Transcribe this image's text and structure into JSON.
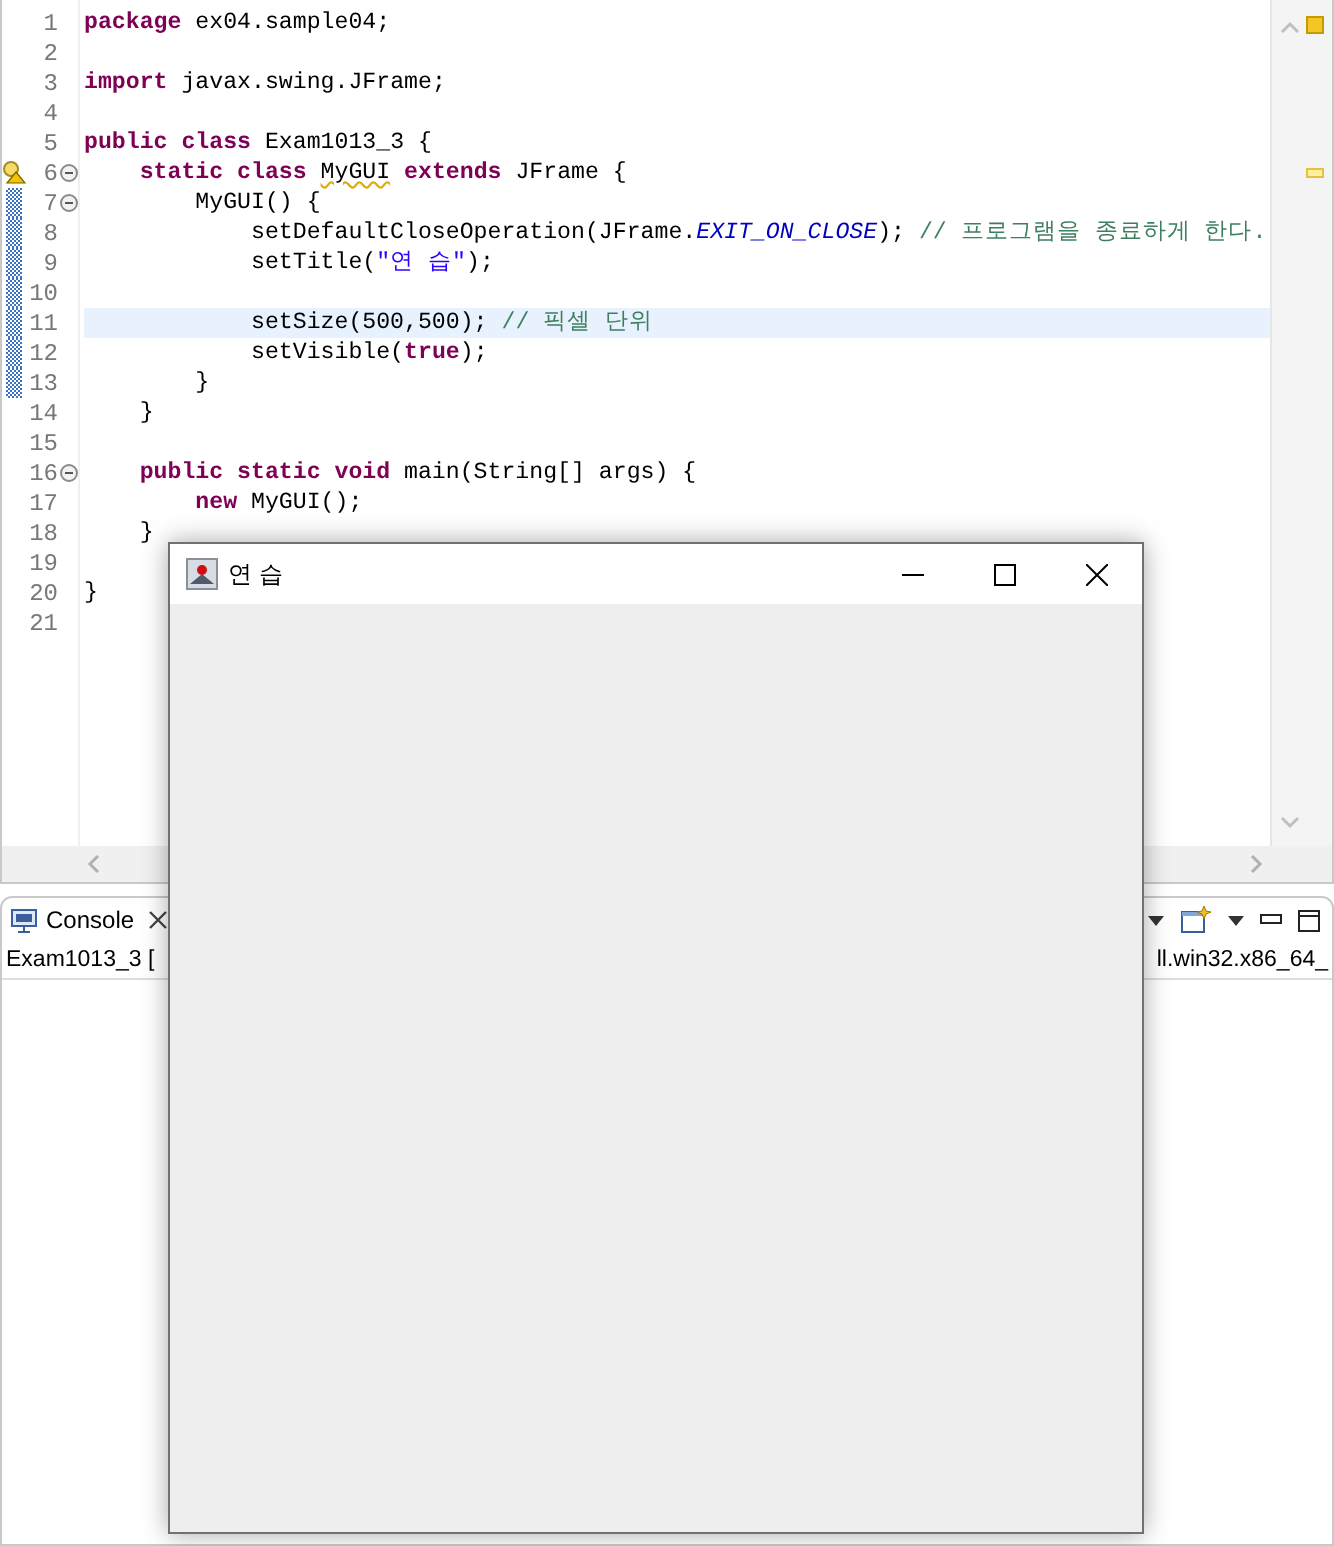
{
  "editor": {
    "lines": [
      {
        "number": "1",
        "fold": false,
        "warning": false,
        "changed": false,
        "current": false,
        "tokens": [
          {
            "kind": "kw",
            "text": "package"
          },
          {
            "kind": "plain",
            "text": " ex04.sample04;"
          }
        ]
      },
      {
        "number": "2",
        "fold": false,
        "warning": false,
        "changed": false,
        "current": false
      },
      {
        "number": "3",
        "fold": false,
        "warning": false,
        "changed": false,
        "current": false,
        "tokens": [
          {
            "kind": "kw",
            "text": "import"
          },
          {
            "kind": "plain",
            "text": " javax.swing.JFrame;"
          }
        ]
      },
      {
        "number": "4",
        "fold": false,
        "warning": false,
        "changed": false,
        "current": false
      },
      {
        "number": "5",
        "fold": false,
        "warning": false,
        "changed": false,
        "current": false,
        "tokens": [
          {
            "kind": "kw",
            "text": "public class"
          },
          {
            "kind": "plain",
            "text": " Exam1013_3 {"
          }
        ]
      },
      {
        "number": "6",
        "fold": true,
        "warning": true,
        "changed": false,
        "current": false,
        "tokens": [
          {
            "kind": "kw",
            "text": "    static class "
          },
          {
            "kind": "squiggle",
            "text": "MyGUI"
          },
          {
            "kind": "kw",
            "text": " extends"
          },
          {
            "kind": "plain",
            "text": " JFrame {"
          }
        ]
      },
      {
        "number": "7",
        "fold": true,
        "warning": false,
        "changed": true,
        "current": false,
        "tokens": [
          {
            "kind": "plain",
            "text": "        MyGUI() {"
          }
        ]
      },
      {
        "number": "8",
        "fold": false,
        "warning": false,
        "changed": true,
        "current": false,
        "tokens": [
          {
            "kind": "plain",
            "text": "            setDefaultCloseOperation(JFrame."
          },
          {
            "kind": "const",
            "text": "EXIT_ON_CLOSE"
          },
          {
            "kind": "plain",
            "text": "); "
          },
          {
            "kind": "comment",
            "text": "// 프로그램을 종료하게 한다."
          }
        ]
      },
      {
        "number": "9",
        "fold": false,
        "warning": false,
        "changed": true,
        "current": false,
        "tokens": [
          {
            "kind": "plain",
            "text": "            setTitle("
          },
          {
            "kind": "str",
            "text": "\"연 습\""
          },
          {
            "kind": "plain",
            "text": ");"
          }
        ]
      },
      {
        "number": "10",
        "fold": false,
        "warning": false,
        "changed": true,
        "current": false
      },
      {
        "number": "11",
        "fold": false,
        "warning": false,
        "changed": true,
        "current": true,
        "tokens": [
          {
            "kind": "plain",
            "text": "            setSize(500,500); "
          },
          {
            "kind": "comment",
            "text": "// 픽셀 단위"
          }
        ]
      },
      {
        "number": "12",
        "fold": false,
        "warning": false,
        "changed": true,
        "current": false,
        "tokens": [
          {
            "kind": "plain",
            "text": "            setVisible("
          },
          {
            "kind": "kw",
            "text": "true"
          },
          {
            "kind": "plain",
            "text": ");"
          }
        ]
      },
      {
        "number": "13",
        "fold": false,
        "warning": false,
        "changed": true,
        "current": false,
        "tokens": [
          {
            "kind": "plain",
            "text": "        }"
          }
        ]
      },
      {
        "number": "14",
        "fold": false,
        "warning": false,
        "changed": false,
        "current": false,
        "tokens": [
          {
            "kind": "plain",
            "text": "    }"
          }
        ]
      },
      {
        "number": "15",
        "fold": false,
        "warning": false,
        "changed": false,
        "current": false
      },
      {
        "number": "16",
        "fold": true,
        "warning": false,
        "changed": false,
        "current": false,
        "tokens": [
          {
            "kind": "kw",
            "text": "    public static void"
          },
          {
            "kind": "plain",
            "text": " main(String[] args) {"
          }
        ]
      },
      {
        "number": "17",
        "fold": false,
        "warning": false,
        "changed": false,
        "current": false,
        "tokens": [
          {
            "kind": "kw",
            "text": "        new"
          },
          {
            "kind": "plain",
            "text": " MyGUI();"
          }
        ]
      },
      {
        "number": "18",
        "fold": false,
        "warning": false,
        "changed": false,
        "current": false,
        "tokens": [
          {
            "kind": "plain",
            "text": "    }"
          }
        ]
      },
      {
        "number": "19",
        "fold": false,
        "warning": false,
        "changed": false,
        "current": false
      },
      {
        "number": "20",
        "fold": false,
        "warning": false,
        "changed": false,
        "current": false,
        "tokens": [
          {
            "kind": "plain",
            "text": "}"
          }
        ]
      },
      {
        "number": "21",
        "fold": false,
        "warning": false,
        "changed": false,
        "current": false
      }
    ]
  },
  "console": {
    "tab": {
      "label": "Console",
      "selected": true
    },
    "description_left": "Exam1013_3 [",
    "description_right": "ll.win32.x86_64_"
  },
  "frame": {
    "title": "연 습"
  }
}
